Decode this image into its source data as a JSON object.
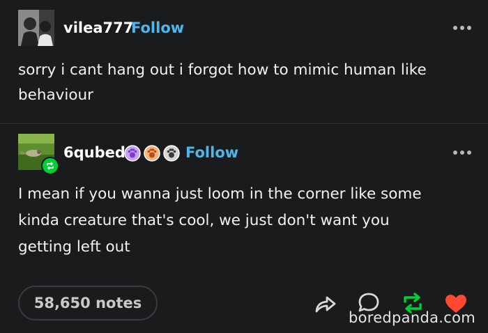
{
  "post1": {
    "username": "vilea777",
    "follow_label": "Follow",
    "lines": [
      "sorry i cant hang out i forgot how to mimic human like",
      "behaviour"
    ]
  },
  "post2": {
    "username": "6qubed",
    "follow_label": "Follow",
    "badges": [
      "purple-paw-badge",
      "orange-paw-badge",
      "gray-paw-badge"
    ],
    "lines": [
      "I mean if you wanna just loom in the corner like some",
      "kinda creature that's cool, we just don't want you",
      "getting left out"
    ]
  },
  "footer": {
    "notes_label": "58,650 notes",
    "actions": [
      "share-icon",
      "reply-icon",
      "reblog-icon",
      "like-icon"
    ]
  },
  "watermark": "boredpanda.com",
  "colors": {
    "background": "#1a1b1d",
    "follow": "#4fb6ea",
    "reblog": "#00cf35",
    "like": "#ff4930"
  }
}
